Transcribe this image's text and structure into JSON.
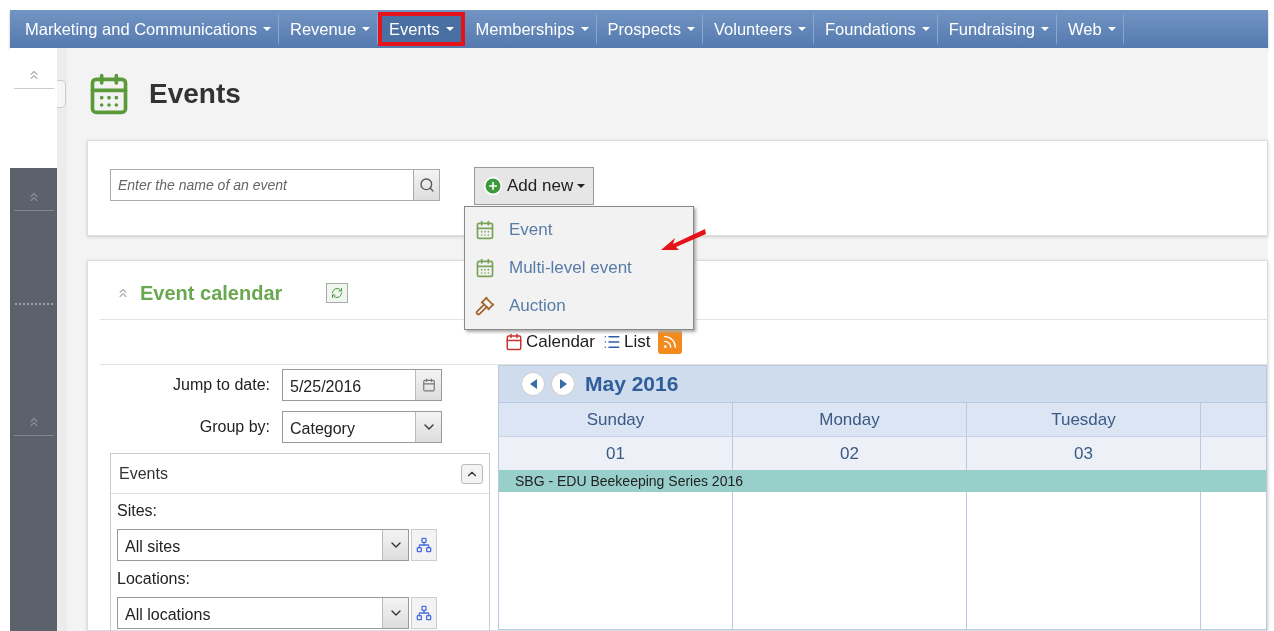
{
  "nav": {
    "items": [
      {
        "label": "Marketing and Communications",
        "highlighted": false
      },
      {
        "label": "Revenue",
        "highlighted": false
      },
      {
        "label": "Events",
        "highlighted": true
      },
      {
        "label": "Memberships",
        "highlighted": false
      },
      {
        "label": "Prospects",
        "highlighted": false
      },
      {
        "label": "Volunteers",
        "highlighted": false
      },
      {
        "label": "Foundations",
        "highlighted": false
      },
      {
        "label": "Fundraising",
        "highlighted": false
      },
      {
        "label": "Web",
        "highlighted": false
      }
    ]
  },
  "page": {
    "title": "Events"
  },
  "search": {
    "placeholder": "Enter the name of an event"
  },
  "add_new": {
    "label": "Add new",
    "expanded": true,
    "menu": [
      {
        "label": "Event",
        "kind": "event"
      },
      {
        "label": "Multi-level event",
        "kind": "event"
      },
      {
        "label": "Auction",
        "kind": "auction"
      }
    ]
  },
  "calendar_panel": {
    "title": "Event calendar",
    "views": [
      {
        "label": "Calendar",
        "kind": "calendar"
      },
      {
        "label": "List",
        "kind": "list"
      },
      {
        "kind": "feed"
      }
    ],
    "jump_to_date": {
      "label": "Jump to date:",
      "value": "5/25/2016"
    },
    "group_by": {
      "label": "Group by:",
      "value": "Category"
    },
    "filters": {
      "title": "Events",
      "fields": [
        {
          "label": "Sites:",
          "value": "All sites"
        },
        {
          "label": "Locations:",
          "value": "All locations"
        }
      ]
    },
    "calendar": {
      "month": "May 2016",
      "days": [
        "Sunday",
        "Monday",
        "Tuesday"
      ],
      "dates": [
        "01",
        "02",
        "03"
      ],
      "events": [
        {
          "title": "SBG - EDU Beekeeping Series 2016",
          "color": "#99cfcb"
        }
      ]
    }
  }
}
